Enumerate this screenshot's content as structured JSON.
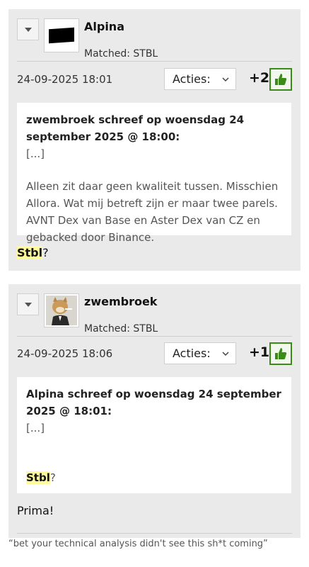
{
  "posts": [
    {
      "username": "Alpina",
      "matched": "Matched: STBL",
      "timestamp": "24-09-2025 18:01",
      "actions_label": "Acties:",
      "score": "+2",
      "quote": {
        "header": "zwembroek schreef op woensdag 24 september 2025 @ 18:00:",
        "ellipsis": "[...]",
        "text": "Alleen zit daar geen kwaliteit tussen. Misschien Allora. Wat mij betreft zijn er maar twee parels. AVNT Dex van Base en Aster Dex van CZ en gebacked door Binance."
      },
      "body": {
        "highlight": "Stbl",
        "rest": "?"
      }
    },
    {
      "username": "zwembroek",
      "matched": "Matched: STBL",
      "timestamp": "24-09-2025 18:06",
      "actions_label": "Acties:",
      "score": "+1",
      "quote": {
        "header": "Alpina schreef op woensdag 24 september 2025 @ 18:01:",
        "ellipsis": "[...]",
        "highlight": "Stbl",
        "rest": "?"
      },
      "body": "Prima!",
      "signature": "“bet your technical analysis didn't see this sh*t coming”"
    }
  ],
  "colors": {
    "post_bg": "#eaeaea",
    "upvote_green": "#3c8a17",
    "highlight": "#fffa9c"
  },
  "icons": {
    "collapse": "triangle-down-icon",
    "dropdown": "chevron-down-icon",
    "upvote": "thumbs-up-icon"
  }
}
